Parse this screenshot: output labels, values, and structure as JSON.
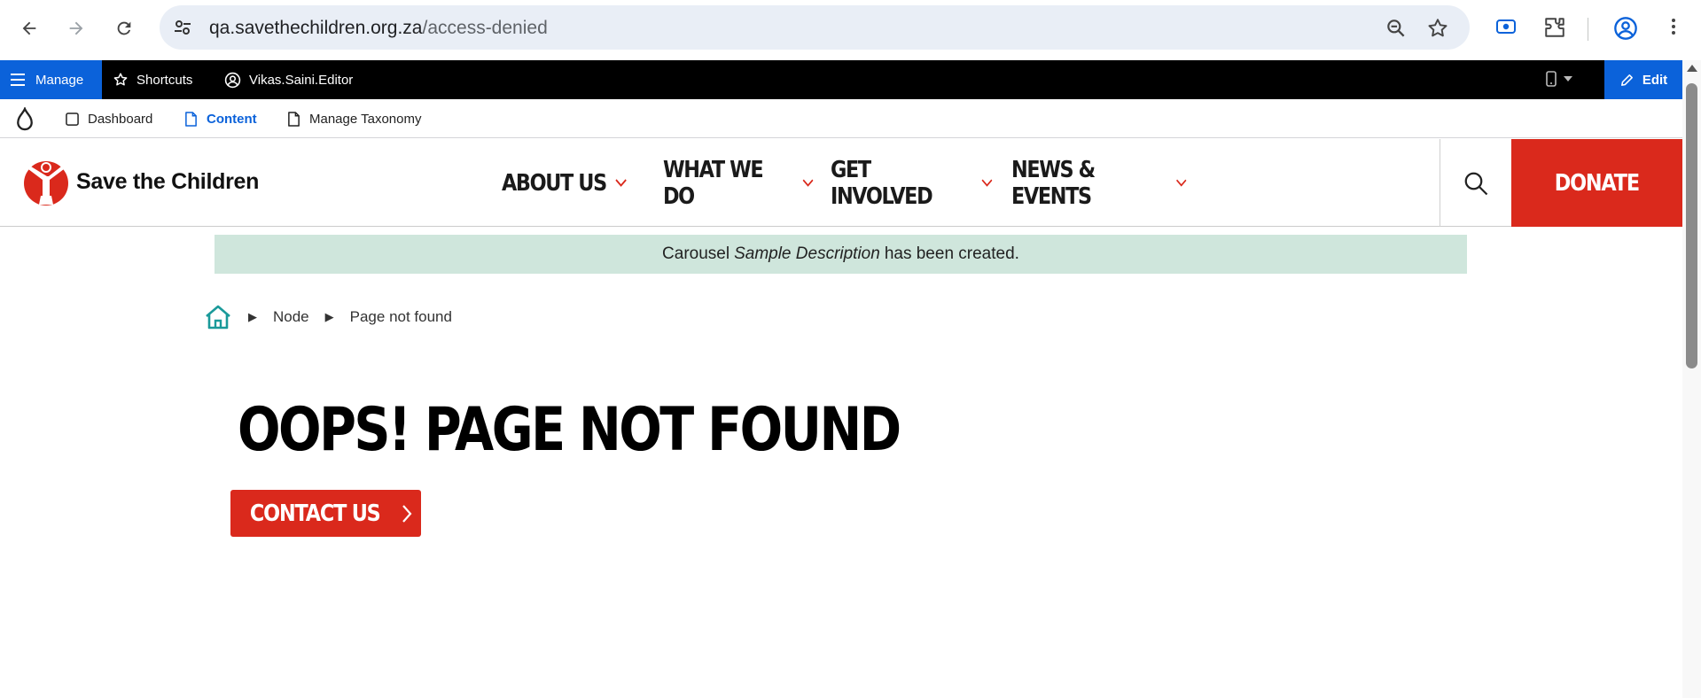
{
  "browser": {
    "url_host": "qa.savethechildren.org.za",
    "url_path": "/access-denied",
    "icons": [
      "back-icon",
      "forward-icon",
      "reload-icon",
      "site-settings-icon",
      "zoom-icon",
      "star-icon",
      "screen-capture-icon",
      "extensions-icon",
      "profile-icon",
      "menu-icon"
    ]
  },
  "admin_toolbar": {
    "manage_label": "Manage",
    "shortcuts_label": "Shortcuts",
    "user_label": "Vikas.Saini.Editor",
    "edit_label": "Edit"
  },
  "admin_tray": {
    "items": [
      {
        "label": "Dashboard"
      },
      {
        "label": "Content",
        "active": true
      },
      {
        "label": "Manage Taxonomy"
      }
    ]
  },
  "site": {
    "logo_text": "Save the Children",
    "nav": [
      {
        "label": "ABOUT US"
      },
      {
        "label": "WHAT WE DO"
      },
      {
        "label": "GET INVOLVED"
      },
      {
        "label": "NEWS & EVENTS"
      }
    ],
    "donate_label": "DONATE"
  },
  "status": {
    "prefix": "Carousel",
    "item": "Sample Description",
    "suffix": "has been created."
  },
  "breadcrumb": {
    "items": [
      "Node",
      "Page not found"
    ]
  },
  "page": {
    "title": "OOPS! PAGE NOT FOUND",
    "contact_label": "CONTACT US"
  },
  "colors": {
    "brand_red": "#da291c",
    "admin_blue": "#0b62da",
    "status_bg": "#cfe6dc",
    "home_icon": "#1a9a9a"
  }
}
